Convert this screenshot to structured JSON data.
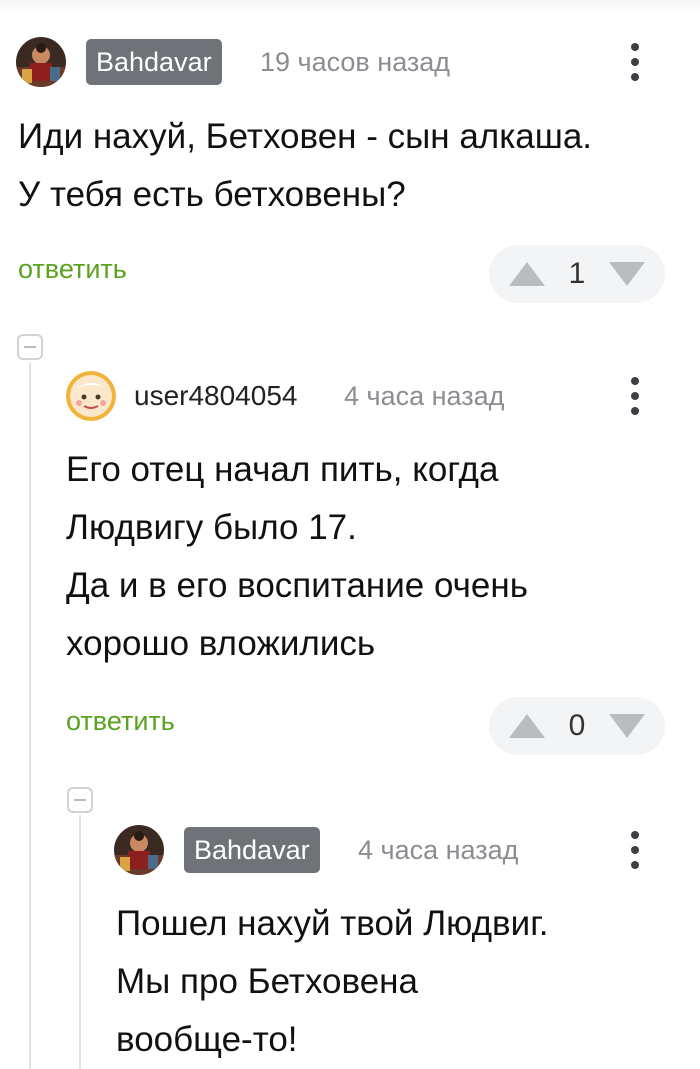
{
  "comments": [
    {
      "author": "Bahdavar",
      "time": "19 часов назад",
      "lines": [
        "Иди нахуй, Бетховен - сын алкаша.",
        "У тебя есть бетховены?"
      ],
      "reply_label": "ответить",
      "rating": "1",
      "avatar_icon": "user-photo-avatar-icon"
    },
    {
      "author": "user4804054",
      "time": "4 часа назад",
      "lines": [
        "Его отец начал пить, когда",
        "Людвигу было 17.",
        "Да и в его воспитание очень",
        "хорошо вложились"
      ],
      "reply_label": "ответить",
      "rating": "0",
      "avatar_icon": "cartoon-face-avatar-icon"
    },
    {
      "author": "Bahdavar",
      "time": "4 часа назад",
      "lines": [
        "Пошел нахуй твой Людвиг.",
        "Мы про Бетховена",
        "вообще-то!"
      ],
      "avatar_icon": "user-photo-avatar-icon"
    }
  ],
  "colors": {
    "reply_link": "#5aa321",
    "badge_bg": "#6f7378",
    "vote_bg": "#f3f4f6"
  }
}
